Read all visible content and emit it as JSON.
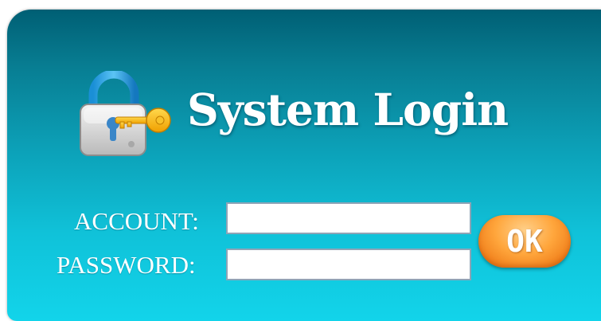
{
  "login": {
    "title": "System Login",
    "account_label": "ACCOUNT:",
    "password_label": "PASSWORD:",
    "account_value": "",
    "password_value": "",
    "ok_label": "OK",
    "icon": "lock-with-key-icon"
  },
  "colors": {
    "panel_top": "#005f74",
    "panel_bottom": "#12d4ea",
    "button_orange": "#f78f2a",
    "field_border": "#8fa4b6"
  }
}
